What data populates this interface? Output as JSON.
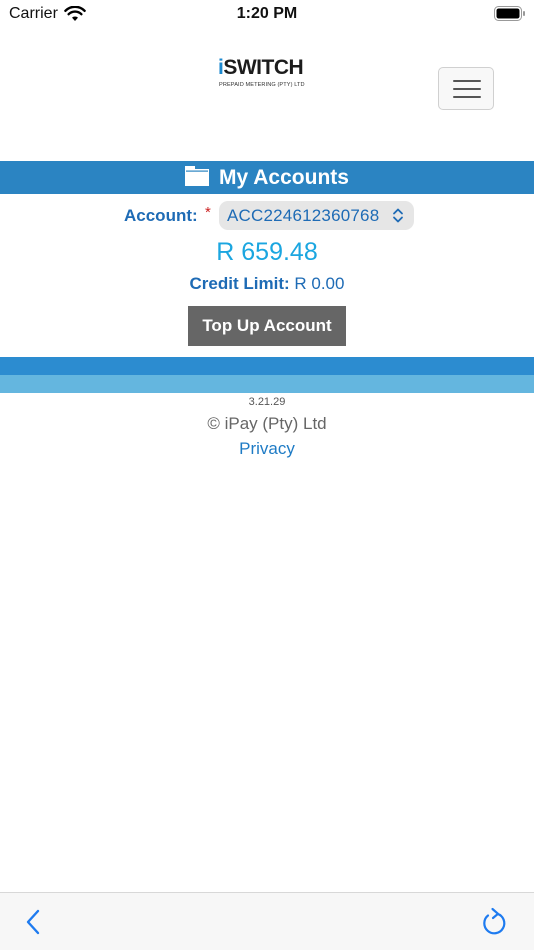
{
  "status_bar": {
    "carrier": "Carrier",
    "time": "1:20 PM",
    "icons": [
      "wifi-icon",
      "battery-icon"
    ]
  },
  "header": {
    "logo_letter": "i",
    "logo_text": "SWITCH",
    "logo_tagline": "PREPAID METERING (PTY) LTD",
    "menu_icon": "hamburger-menu-icon"
  },
  "section": {
    "title": "My Accounts",
    "icon": "folder-icon"
  },
  "account": {
    "label": "Account:",
    "required_mark": "*",
    "selected": "ACC224612360768"
  },
  "balance": "R 659.48",
  "credit": {
    "label": "Credit Limit:",
    "value": " R 0.00"
  },
  "actions": {
    "top_up_label": "Top Up Account"
  },
  "footer": {
    "version": "3.21.29",
    "copyright": "© iPay (Pty) Ltd",
    "privacy_label": "Privacy"
  },
  "toolbar": {
    "icons": [
      "back-icon",
      "reload-icon"
    ]
  },
  "colors": {
    "band_blue": "#2b84c2",
    "stripe_dark": "#2c8cd0",
    "stripe_light": "#64b6df",
    "link_blue": "#1e6bb5",
    "balance_blue": "#1ba6e0",
    "button_gray": "#666666"
  }
}
